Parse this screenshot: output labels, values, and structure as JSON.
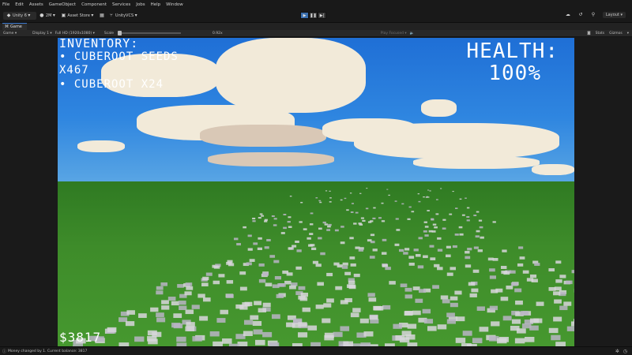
{
  "menu": [
    "File",
    "Edit",
    "Assets",
    "GameObject",
    "Component",
    "Services",
    "Jobs",
    "Help",
    "Window"
  ],
  "toolbar": {
    "unity_label": "Unity 6",
    "account_label": "2M",
    "asset_store_label": "Asset Store",
    "vcs_label": "UnityVCS",
    "layout_label": "Layout"
  },
  "tab": {
    "label": "Game"
  },
  "gamebar": {
    "game_dropdown": "Game",
    "display": "Display 1",
    "resolution": "Full HD (1920x1080)",
    "scale_label": "Scale",
    "scale_value": "0.92x",
    "play_mode": "Play Focused",
    "stats": "Stats",
    "gizmos": "Gizmos"
  },
  "hud": {
    "inventory_title": "INVENTORY:",
    "item1_line1": "• CUBEROOT SEEDS",
    "item1_line2": "X467",
    "item2": "• CUBEROOT X24",
    "health_label": "HEALTH:",
    "health_value": "100%",
    "money": "$3817"
  },
  "status": {
    "message": "Money changed by 1. Current balance: 3817"
  },
  "colors": {
    "sky_top": "#1f6fd6",
    "grass": "#3e8c2a",
    "play_active": "#3b6fae",
    "hud_text": "#ffffff"
  }
}
